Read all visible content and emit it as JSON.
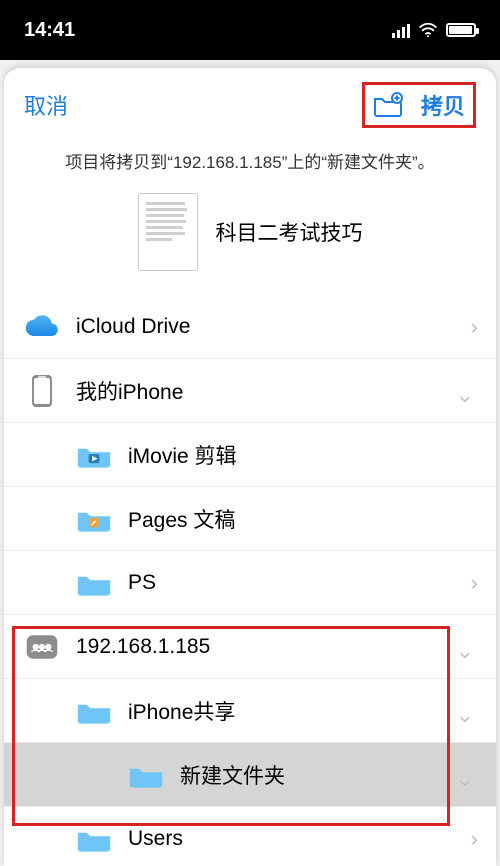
{
  "status": {
    "time": "14:41"
  },
  "nav": {
    "cancel": "取消",
    "copy": "拷贝"
  },
  "info_text": "项目将拷贝到“192.168.1.185”上的“新建文件夹”。",
  "document": {
    "title": "科目二考试技巧"
  },
  "rows": {
    "icloud": "iCloud Drive",
    "myiphone": "我的iPhone",
    "imovie": "iMovie 剪辑",
    "pages": "Pages 文稿",
    "ps": "PS",
    "server": "192.168.1.185",
    "share": "iPhone共享",
    "newfolder": "新建文件夹",
    "users": "Users"
  },
  "icons": {
    "folder_color": "#6fc6f6",
    "accent": "#1e7de0",
    "annot": "#d62323"
  }
}
